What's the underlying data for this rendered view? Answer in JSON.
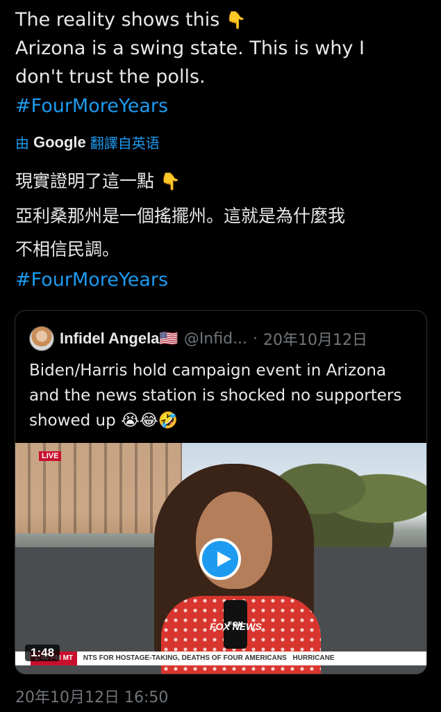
{
  "post": {
    "line1_text": "The reality shows this",
    "line1_emoji": "👇",
    "line2": "Arizona is a swing state. This is why I",
    "line3": "don't trust the polls.",
    "hashtag": "#FourMoreYears",
    "translated_by_prefix": "由",
    "translated_by_brand": "Google",
    "translated_by_suffix": "翻譯自英语",
    "translated_line1": "現實證明了這一點",
    "translated_line1_emoji": "👇",
    "translated_line2": "亞利桑那州是一個搖擺州。這就是為什麼我",
    "translated_line3": "不相信民調。",
    "translated_hashtag": "#FourMoreYears",
    "timestamp": "20年10月12日 16:50"
  },
  "quote": {
    "name": "Infidel Angela🇺🇸",
    "handle": "@Infid...",
    "separator": "·",
    "date": "20年10月12日",
    "body": "Biden/Harris hold campaign event in Arizona and the news station is shocked no supporters showed up 😭😂🤣",
    "video": {
      "duration": "1:48",
      "live_label": "LIVE",
      "ticker_time": "2:46 PM MT",
      "ticker_text": "NTS FOR HOSTAGE-TAKING, DEATHS OF FOUR AMERICANS",
      "ticker_extra": "HURRICANE",
      "mic_label": "FOX",
      "network_bug": "FOX NEWS"
    }
  },
  "colors": {
    "accent": "#1d9bf0",
    "text": "#e7e9ea",
    "muted": "#71767b",
    "background": "#000000"
  }
}
